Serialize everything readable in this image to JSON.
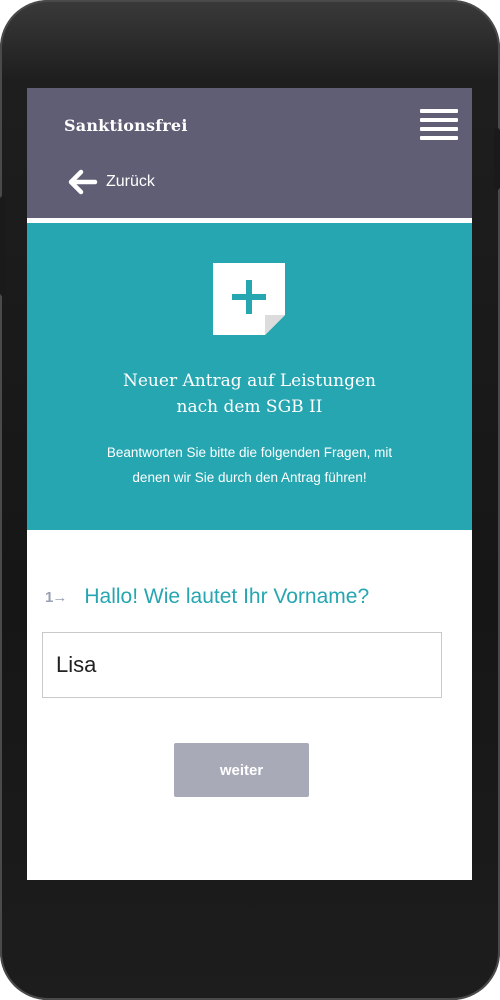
{
  "app": {
    "brand": "Sanktionsfrei"
  },
  "nav": {
    "back_label": "Zurück"
  },
  "hero": {
    "icon": "new-document-plus-icon",
    "title_line1": "Neuer Antrag auf Leistungen",
    "title_line2": "nach dem SGB II",
    "subtitle_line1": "Beantworten Sie bitte die folgenden Fragen, mit",
    "subtitle_line2": "denen wir Sie durch den Antrag führen!"
  },
  "question": {
    "number": "1",
    "arrow": "→",
    "text": "Hallo! Wie lautet Ihr Vorname?",
    "value": "Lisa"
  },
  "actions": {
    "next_label": "weiter"
  },
  "colors": {
    "topbar": "#5f5e74",
    "accent": "#26a6b1",
    "button": "#a8aab8"
  }
}
